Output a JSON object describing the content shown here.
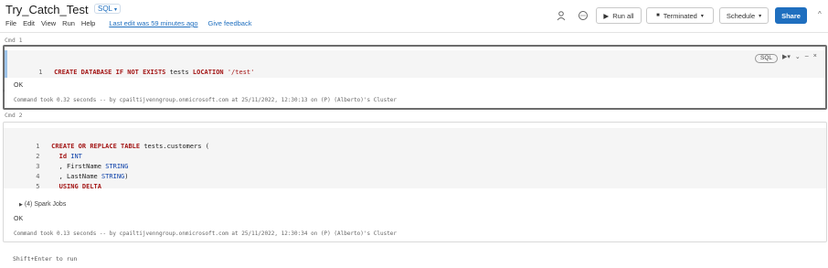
{
  "notebook": {
    "title": "Try_Catch_Test",
    "language": "SQL",
    "menu": [
      "File",
      "Edit",
      "View",
      "Run",
      "Help"
    ],
    "last_edit": "Last edit was 59 minutes ago",
    "feedback": "Give feedback"
  },
  "toolbar": {
    "run_all": "Run all",
    "cluster_status": "Terminated",
    "schedule": "Schedule",
    "share": "Share"
  },
  "cells": [
    {
      "label": "Cmd 1",
      "lang_pill": "SQL",
      "code": [
        {
          "n": "1",
          "segments": [
            {
              "t": "CREATE DATABASE IF NOT EXISTS",
              "c": "kw"
            },
            {
              "t": " tests ",
              "c": "ident"
            },
            {
              "t": "LOCATION",
              "c": "kw"
            },
            {
              "t": " ",
              "c": "ident"
            },
            {
              "t": "'/test'",
              "c": "str"
            }
          ]
        }
      ],
      "result": "OK",
      "took": "Command took 0.32 seconds -- by cpailtijvenngroup.onmicrosoft.com at 25/11/2022, 12:30:13 on (P) (Alberto)'s Cluster"
    },
    {
      "label": "Cmd 2",
      "code": [
        {
          "n": "1",
          "segments": [
            {
              "t": "CREATE OR REPLACE TABLE",
              "c": "kw"
            },
            {
              "t": " tests.customers (",
              "c": "ident"
            }
          ]
        },
        {
          "n": "2",
          "segments": [
            {
              "t": "  Id ",
              "c": "kw"
            },
            {
              "t": "INT",
              "c": "type"
            }
          ]
        },
        {
          "n": "3",
          "segments": [
            {
              "t": "  , FirstName ",
              "c": "ident"
            },
            {
              "t": "STRING",
              "c": "type"
            }
          ]
        },
        {
          "n": "4",
          "segments": [
            {
              "t": "  , LastName ",
              "c": "ident"
            },
            {
              "t": "STRING",
              "c": "type"
            },
            {
              "t": ")",
              "c": "ident"
            }
          ]
        },
        {
          "n": "5",
          "segments": [
            {
              "t": "  USING DELTA",
              "c": "kw"
            }
          ]
        }
      ],
      "spark_jobs": "(4) Spark Jobs",
      "result": "OK",
      "took": "Command took 0.13 seconds -- by cpailtijvenngroup.onmicrosoft.com at 25/11/2022, 12:30:34 on (P) (Alberto)'s Cluster"
    }
  ],
  "footer_hint": "Shift+Enter to run",
  "colors": {
    "accent": "#1f6fbf",
    "keyword": "#a31515",
    "type": "#0a3fa8",
    "active_cell_border": "#6d6d6d"
  },
  "icons": [
    "person-icon",
    "comment-icon",
    "play-icon",
    "stop-square-icon",
    "chevron-down-icon",
    "run-cell-icon",
    "minimize-icon",
    "close-icon",
    "chevron-up-icon",
    "triangle-right-icon"
  ]
}
